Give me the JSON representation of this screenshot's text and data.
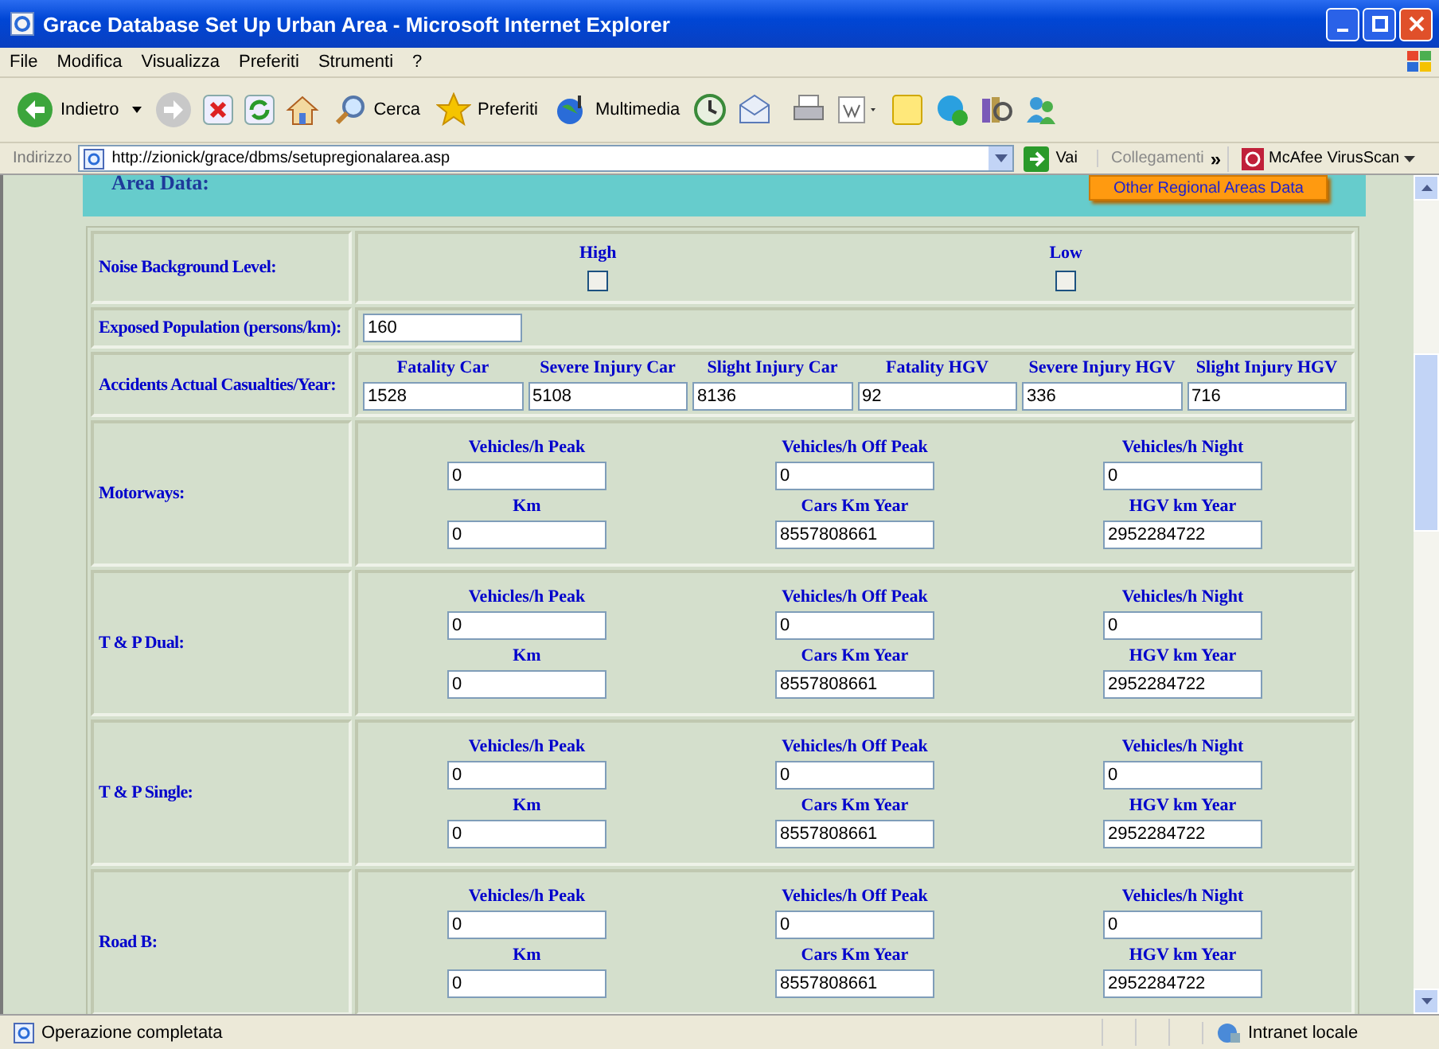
{
  "window": {
    "title": "Grace Database Set Up Urban Area - Microsoft Internet Explorer"
  },
  "menu": [
    "File",
    "Modifica",
    "Visualizza",
    "Preferiti",
    "Strumenti",
    "?"
  ],
  "toolbar": [
    {
      "kind": "back",
      "label": "Indietro"
    },
    {
      "kind": "search",
      "label": "Cerca"
    },
    {
      "kind": "favorites",
      "label": "Preferiti"
    },
    {
      "kind": "media",
      "label": "Multimedia"
    }
  ],
  "address": {
    "label": "Indirizzo",
    "url": "http://zionick/grace/dbms/setupregionalarea.asp",
    "go": "Vai",
    "links": "Collegamenti",
    "chevron": "»",
    "extension": "McAfee VirusScan"
  },
  "page": {
    "heading": "Area Data:",
    "button": "Other Regional Areas Data",
    "noise": {
      "label": "Noise Background Level:",
      "options": [
        {
          "label": "High",
          "checked": false
        },
        {
          "label": "Low",
          "checked": false
        }
      ]
    },
    "population": {
      "label": "Exposed Population (persons/km):",
      "value": "160"
    },
    "accidents": {
      "label": "Accidents Actual Casualties/Year:",
      "fields": [
        {
          "label": "Fatality Car",
          "value": "1528"
        },
        {
          "label": "Severe Injury Car",
          "value": "5108"
        },
        {
          "label": "Slight Injury Car",
          "value": "8136"
        },
        {
          "label": "Fatality HGV",
          "value": "92"
        },
        {
          "label": "Severe Injury HGV",
          "value": "336"
        },
        {
          "label": "Slight Injury HGV",
          "value": "716"
        }
      ]
    },
    "roads": [
      {
        "name": "Motorways:",
        "fields": [
          {
            "label": "Vehicles/h Peak",
            "value": "0"
          },
          {
            "label": "Vehicles/h Off Peak",
            "value": "0"
          },
          {
            "label": "Vehicles/h Night",
            "value": "0"
          },
          {
            "label": "Km",
            "value": "0"
          },
          {
            "label": "Cars Km Year",
            "value": "8557808661"
          },
          {
            "label": "HGV km Year",
            "value": "2952284722"
          }
        ]
      },
      {
        "name": "T & P Dual:",
        "fields": [
          {
            "label": "Vehicles/h Peak",
            "value": "0"
          },
          {
            "label": "Vehicles/h Off Peak",
            "value": "0"
          },
          {
            "label": "Vehicles/h Night",
            "value": "0"
          },
          {
            "label": "Km",
            "value": "0"
          },
          {
            "label": "Cars Km Year",
            "value": "8557808661"
          },
          {
            "label": "HGV km Year",
            "value": "2952284722"
          }
        ]
      },
      {
        "name": "T & P Single:",
        "fields": [
          {
            "label": "Vehicles/h Peak",
            "value": "0"
          },
          {
            "label": "Vehicles/h Off Peak",
            "value": "0"
          },
          {
            "label": "Vehicles/h Night",
            "value": "0"
          },
          {
            "label": "Km",
            "value": "0"
          },
          {
            "label": "Cars Km Year",
            "value": "8557808661"
          },
          {
            "label": "HGV km Year",
            "value": "2952284722"
          }
        ]
      },
      {
        "name": "Road B:",
        "fields": [
          {
            "label": "Vehicles/h Peak",
            "value": "0"
          },
          {
            "label": "Vehicles/h Off Peak",
            "value": "0"
          },
          {
            "label": "Vehicles/h Night",
            "value": "0"
          },
          {
            "label": "Km",
            "value": "0"
          },
          {
            "label": "Cars Km Year",
            "value": "8557808661"
          },
          {
            "label": "HGV km Year",
            "value": "2952284722"
          }
        ]
      }
    ]
  },
  "status": {
    "text": "Operazione completata",
    "zone": "Intranet locale"
  }
}
